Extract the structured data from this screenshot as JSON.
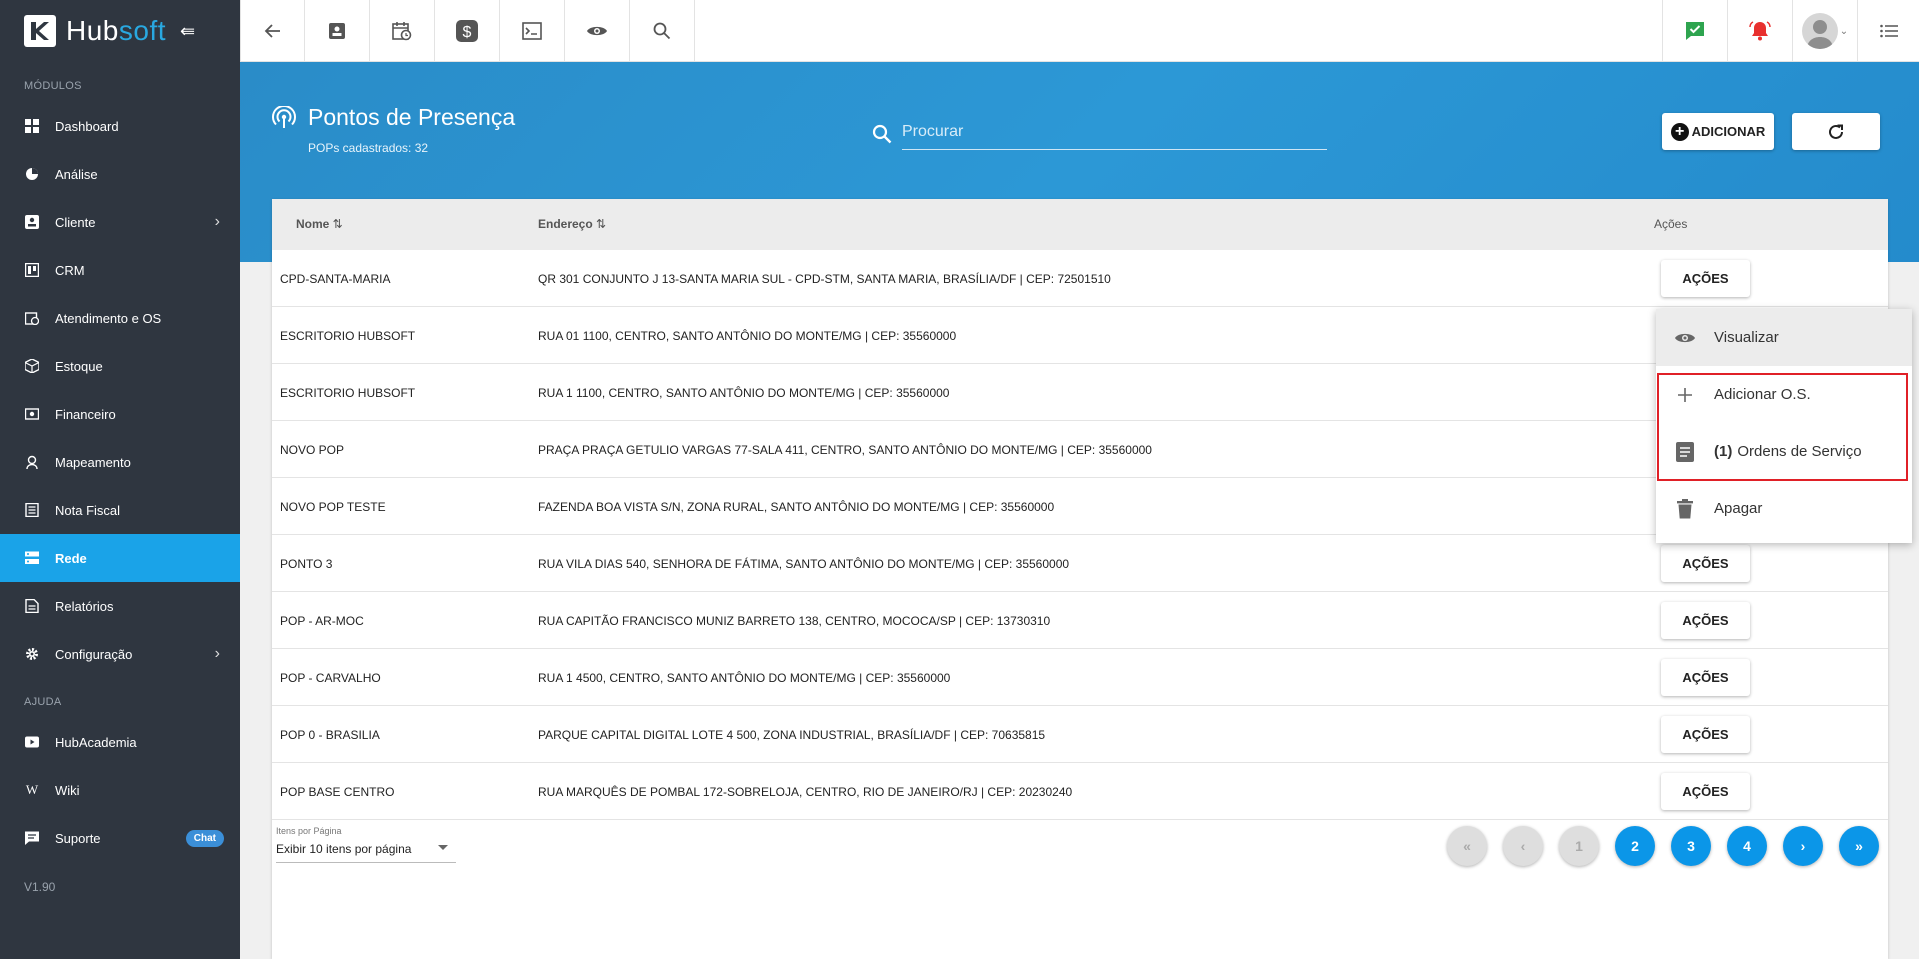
{
  "brand": {
    "logo_text_hub": "Hub",
    "logo_text_soft": "soft"
  },
  "sidebar": {
    "section_modulos": "MÓDULOS",
    "section_ajuda": "AJUDA",
    "items": [
      {
        "label": "Dashboard"
      },
      {
        "label": "Análise"
      },
      {
        "label": "Cliente"
      },
      {
        "label": "CRM"
      },
      {
        "label": "Atendimento e OS"
      },
      {
        "label": "Estoque"
      },
      {
        "label": "Financeiro"
      },
      {
        "label": "Mapeamento"
      },
      {
        "label": "Nota Fiscal"
      },
      {
        "label": "Rede"
      },
      {
        "label": "Relatórios"
      },
      {
        "label": "Configuração"
      }
    ],
    "help_items": [
      {
        "label": "HubAcademia"
      },
      {
        "label": "Wiki"
      },
      {
        "label": "Suporte",
        "badge": "Chat"
      }
    ],
    "version": "V1.90"
  },
  "header": {
    "title": "Pontos de Presença",
    "subtitle": "POPs cadastrados: 32",
    "search_placeholder": "Procurar",
    "add_label": "ADICIONAR"
  },
  "table": {
    "columns": {
      "name": "Nome",
      "address": "Endereço",
      "actions": "Ações"
    },
    "action_label": "AÇÕES",
    "rows": [
      {
        "name": "CPD-SANTA-MARIA",
        "address": "QR 301 CONJUNTO J 13-SANTA MARIA SUL - CPD-STM, SANTA MARIA, BRASÍLIA/DF | CEP: 72501510"
      },
      {
        "name": "ESCRITORIO HUBSOFT",
        "address": "RUA 01 1100, CENTRO, SANTO ANTÔNIO DO MONTE/MG | CEP: 35560000"
      },
      {
        "name": "ESCRITORIO HUBSOFT",
        "address": "RUA 1 1100, CENTRO, SANTO ANTÔNIO DO MONTE/MG | CEP: 35560000"
      },
      {
        "name": "NOVO POP",
        "address": "PRAÇA PRAÇA GETULIO VARGAS 77-SALA 411, CENTRO, SANTO ANTÔNIO DO MONTE/MG | CEP: 35560000"
      },
      {
        "name": "NOVO POP TESTE",
        "address": "FAZENDA BOA VISTA S/N, ZONA RURAL, SANTO ANTÔNIO DO MONTE/MG | CEP: 35560000"
      },
      {
        "name": "PONTO 3",
        "address": "RUA VILA DIAS 540, SENHORA DE FÁTIMA, SANTO ANTÔNIO DO MONTE/MG | CEP: 35560000"
      },
      {
        "name": "POP - AR-MOC",
        "address": "RUA CAPITÃO FRANCISCO MUNIZ BARRETO 138, CENTRO, MOCOCA/SP | CEP: 13730310"
      },
      {
        "name": "POP - CARVALHO",
        "address": "RUA 1 4500, CENTRO, SANTO ANTÔNIO DO MONTE/MG | CEP: 35560000"
      },
      {
        "name": "POP 0 - BRASILIA",
        "address": "PARQUE CAPITAL DIGITAL LOTE 4 500, ZONA INDUSTRIAL, BRASÍLIA/DF | CEP: 70635815"
      },
      {
        "name": "POP BASE CENTRO",
        "address": "RUA MARQUÊS DE POMBAL 172-SOBRELOJA, CENTRO, RIO DE JANEIRO/RJ | CEP: 20230240"
      }
    ]
  },
  "pagination": {
    "per_page_label": "Itens por Página",
    "per_page_value": "Exibir 10 itens por página",
    "first": "«",
    "prev": "‹",
    "pages": [
      "1",
      "2",
      "3",
      "4"
    ],
    "next": "›",
    "last": "»",
    "current_page": "1"
  },
  "actions_menu": {
    "items": [
      {
        "label": "Visualizar"
      },
      {
        "label": "Adicionar O.S."
      },
      {
        "count": "(1)",
        "label": "Ordens de Serviço"
      },
      {
        "label": "Apagar"
      }
    ]
  },
  "colors": {
    "sidebar_bg": "#2f3640",
    "accent": "#1aa3e8",
    "highlight_border": "#e02027"
  }
}
